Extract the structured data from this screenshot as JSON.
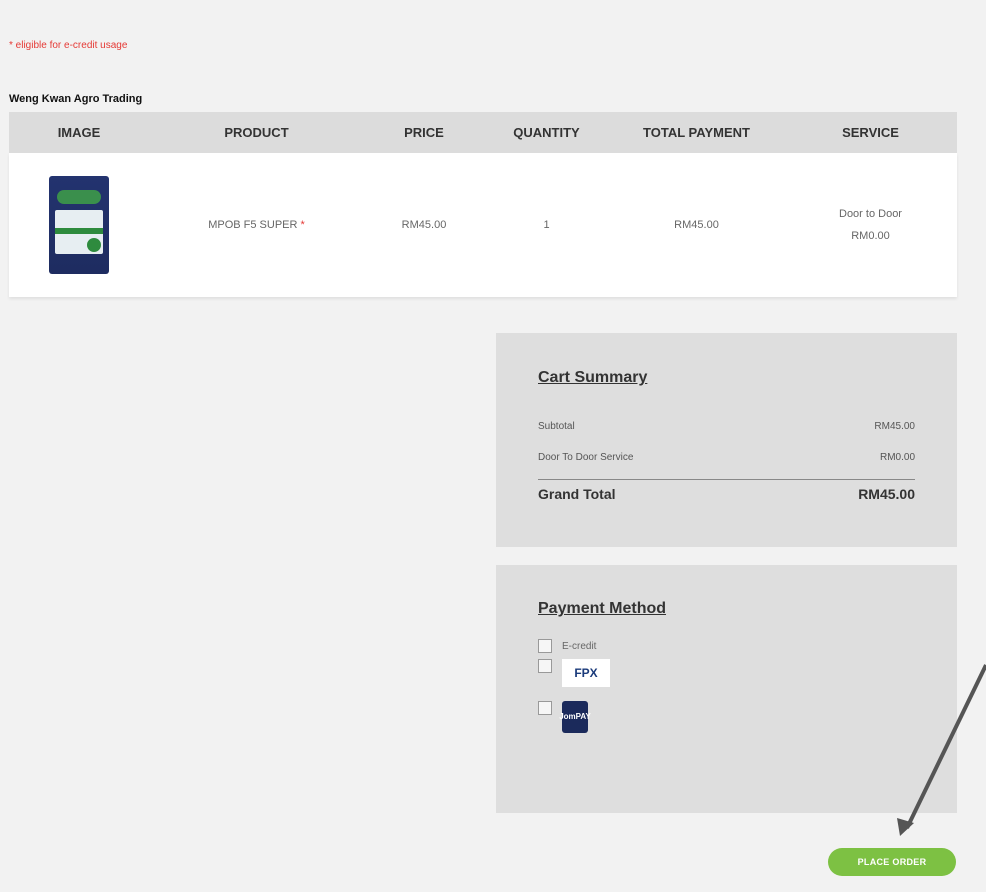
{
  "notice": "* eligible for e-credit usage",
  "store_name": "Weng Kwan Agro Trading",
  "table": {
    "headers": [
      "IMAGE",
      "PRODUCT",
      "PRICE",
      "QUANTITY",
      "TOTAL PAYMENT",
      "SERVICE"
    ],
    "row": {
      "product": "MPOB F5 SUPER",
      "required_mark": "*",
      "price": "RM45.00",
      "quantity": "1",
      "total": "RM45.00",
      "service_name": "Door to Door",
      "service_price": "RM0.00"
    }
  },
  "cart_summary": {
    "title": "Cart Summary",
    "subtotal_label": "Subtotal",
    "subtotal_value": "RM45.00",
    "service_label": "Door To Door Service",
    "service_value": "RM0.00",
    "grand_label": "Grand Total",
    "grand_value": "RM45.00"
  },
  "payment": {
    "title": "Payment Method",
    "ecredit_label": "E-credit",
    "fpx_label": "FPX",
    "jompay_label": "JomPAY"
  },
  "place_order_label": "PLACE ORDER",
  "colors": {
    "accent_green": "#7dc143",
    "notice_red": "#e53935",
    "arrow_gray": "#555555"
  }
}
